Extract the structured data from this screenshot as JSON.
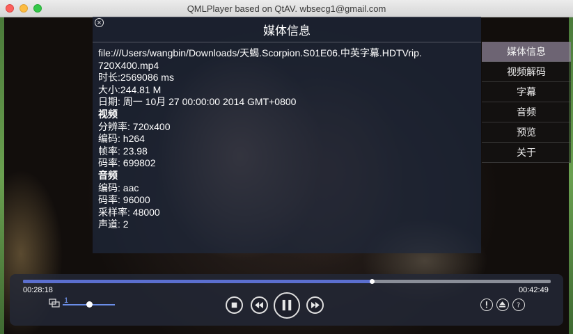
{
  "window": {
    "title": "QMLPlayer based on QtAV. wbsecg1@gmail.com"
  },
  "panel": {
    "title": "媒体信息",
    "lines": [
      "file:///Users/wangbin/Downloads/天蝎.Scorpion.S01E06.中英字幕.HDTVrip.",
      "720X400.mp4",
      "时长:2569086 ms",
      "大小:244.81 M",
      "日期: 周一 10月 27 00:00:00 2014 GMT+0800",
      "视频",
      "分辨率: 720x400",
      "编码: h264",
      "帧率: 23.98",
      "码率: 699802",
      "音频",
      "编码: aac",
      "码率: 96000",
      "采样率: 48000",
      "声道: 2"
    ]
  },
  "menu": {
    "items": [
      "媒体信息",
      "视频解码",
      "字幕",
      "音频",
      "预览",
      "关于"
    ],
    "active_index": 0
  },
  "controls": {
    "elapsed": "00:28:18",
    "total": "00:42:49",
    "progress": 0.661,
    "volume_label": "1",
    "volume_level": 0.45
  },
  "icons": {
    "close": "close-circle-icon",
    "volume": "volume-icon",
    "stop": "stop-icon",
    "rewind": "rewind-icon",
    "pause": "pause-icon",
    "fast_forward": "fast-forward-icon",
    "info": "info-icon",
    "eject": "eject-icon",
    "help": "help-icon"
  },
  "colors": {
    "progress": "#5b6fcf",
    "menu_active": "#8c8296"
  }
}
